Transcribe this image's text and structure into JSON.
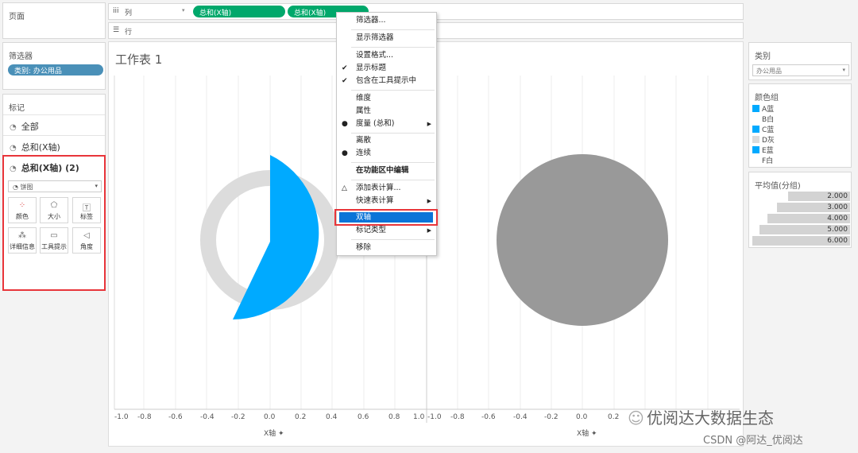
{
  "left": {
    "pages_title": "页面",
    "filters_title": "筛选器",
    "filter_pill": "类别: 办公用品",
    "marks_title": "标记",
    "marks_rows": [
      "全部",
      "总和(X轴)",
      "总和(X轴) (2)"
    ],
    "mark_type": "饼图",
    "cards": [
      "颜色",
      "大小",
      "标签",
      "详细信息",
      "工具提示",
      "角度"
    ]
  },
  "shelves": {
    "columns_label": "列",
    "rows_label": "行",
    "pill1": "总和(X轴)",
    "pill2": "总和(X轴)"
  },
  "sheet_title": "工作表 1",
  "menu": {
    "items": [
      "筛选器...",
      "显示筛选器",
      "设置格式...",
      "显示标题",
      "包含在工具提示中",
      "维度",
      "属性",
      "度量 (总和)",
      "离散",
      "连续",
      "在功能区中编辑",
      "添加表计算...",
      "快速表计算",
      "双轴",
      "标记类型",
      "移除"
    ]
  },
  "axis": {
    "ticks": [
      "-1.0",
      "-0.8",
      "-0.6",
      "-0.4",
      "-0.2",
      "0.0",
      "0.2",
      "0.4",
      "0.6",
      "0.8",
      "1.0"
    ],
    "label": "X轴",
    "pin_icon": "pin-icon"
  },
  "right": {
    "category_title": "类别",
    "category_value": "办公用品",
    "color_title": "颜色组",
    "color_items": [
      "A蓝",
      "B白",
      "C蓝",
      "D灰",
      "E蓝",
      "F白"
    ],
    "avg_title": "平均值(分组)",
    "avg_values": [
      "2.000",
      "3.000",
      "4.000",
      "5.000",
      "6.000"
    ]
  },
  "colors": {
    "blue": "#00aaff",
    "light_gray": "#dcdcdc",
    "gray": "#999999",
    "green": "#00a86b",
    "highlight": "#0b74d8",
    "red": "#e8353a"
  },
  "watermark": {
    "line1": "优阅达大数据生态",
    "line2": "CSDN @阿达_优阅达"
  }
}
